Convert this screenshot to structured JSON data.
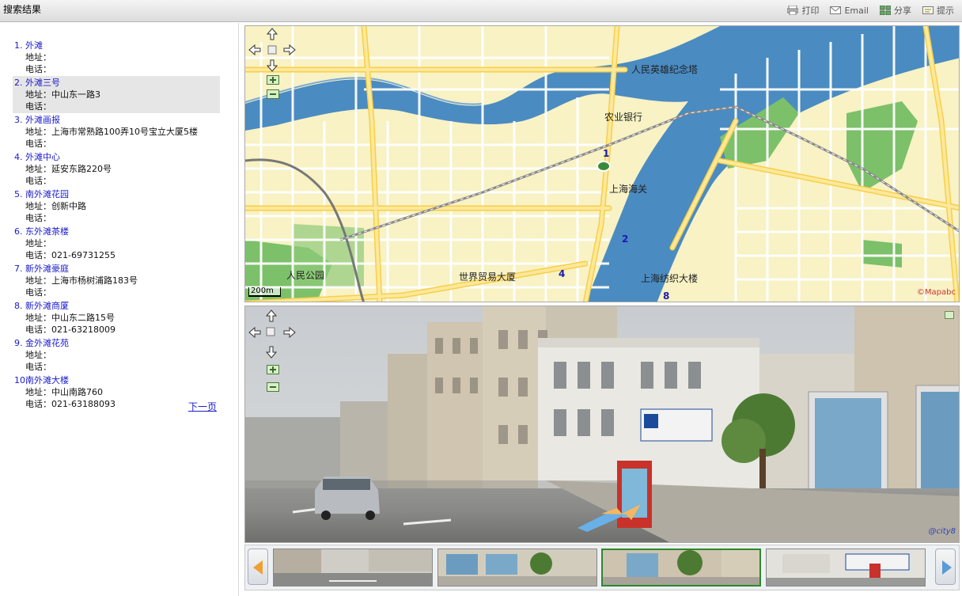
{
  "header": {
    "title": "搜索结果",
    "tools": [
      {
        "label": "打印",
        "icon": "printer-icon"
      },
      {
        "label": "Email",
        "icon": "email-icon"
      },
      {
        "label": "分享",
        "icon": "share-icon"
      },
      {
        "label": "提示",
        "icon": "tip-icon"
      }
    ]
  },
  "results": {
    "address_label": "地址：",
    "phone_label": "电话：",
    "items": [
      {
        "num": "1.",
        "name": "外滩",
        "address": "",
        "phone": ""
      },
      {
        "num": "2.",
        "name": "外滩三号",
        "address": "中山东一路3",
        "phone": ""
      },
      {
        "num": "3.",
        "name": "外滩画报",
        "address": "上海市常熟路100弄10号宝立大厦5楼",
        "phone": ""
      },
      {
        "num": "4.",
        "name": "外滩中心",
        "address": "延安东路220号",
        "phone": ""
      },
      {
        "num": "5.",
        "name": "南外滩花园",
        "address": "创新中路",
        "phone": ""
      },
      {
        "num": "6.",
        "name": "东外滩茶楼",
        "address": "",
        "phone": "021-69731255"
      },
      {
        "num": "7.",
        "name": "新外滩豪庭",
        "address": "上海市杨树浦路183号",
        "phone": ""
      },
      {
        "num": "8.",
        "name": "新外滩商厦",
        "address": "中山东二路15号",
        "phone": "021-63218009"
      },
      {
        "num": "9.",
        "name": "金外滩花苑",
        "address": "",
        "phone": ""
      },
      {
        "num": "10.",
        "name": "南外滩大楼",
        "address": "中山南路760",
        "phone": "021-63188093"
      }
    ],
    "selected_index": 1,
    "next_page": "下一页"
  },
  "map": {
    "labels": {
      "monument": "人民英雄纪念塔",
      "bank": "农业银行",
      "customs": "上海海关",
      "park": "人民公园",
      "trade": "世界贸易大厦",
      "textile": "上海纺织大楼"
    },
    "markers": [
      "1",
      "2",
      "4",
      "8"
    ],
    "scale": "200m",
    "copyright": "©Mapabc",
    "colors": {
      "land": "#f8f2c4",
      "road": "#ffe89a",
      "major_road": "#f6cf4a",
      "water": "#4a8bc2",
      "park": "#7cc06a"
    }
  },
  "streetview": {
    "watermark": "@city8"
  },
  "thumbnails": {
    "count": 4,
    "selected_index": 2
  }
}
